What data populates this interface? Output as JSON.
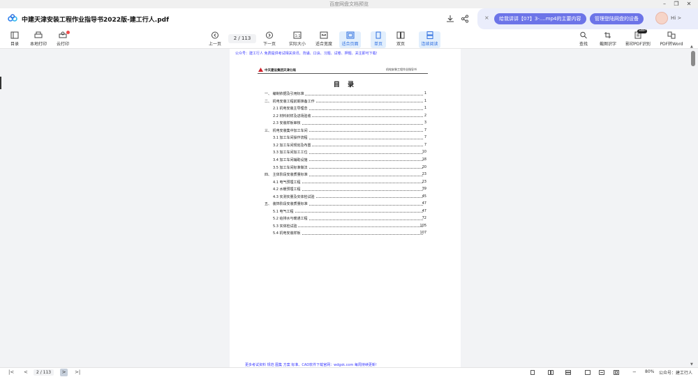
{
  "window": {
    "title": "百度网盘文档预览"
  },
  "header": {
    "filename": "中建天津安装工程作业指导书2022版-建工行人.pdf",
    "pill1": "给我讲讲【07】3-....mp4的主要内容",
    "pill2": "管理登陆网盘的设备",
    "hi": "Hi >",
    "close": "×"
  },
  "toolbar": {
    "toc": "目录",
    "local_print": "本地打印",
    "cloud_print": "云打印",
    "prev": "上一页",
    "page_indicator": "2 / 113",
    "next": "下一页",
    "actual_size": "实际大小",
    "fit_width": "适合宽度",
    "fit_page": "适合页面",
    "single": "单页",
    "double": "双页",
    "continuous": "连续阅读",
    "find": "查找",
    "screenshot_ocr": "截图识字",
    "image_pdf_ocr": "影印PDF识别",
    "pdf_to_word": "PDF转Word",
    "new_tag": "SWP"
  },
  "document": {
    "promo_top": "公众号：建工行人 免费提供考试相关资讯、背诵、口诀、习题、试卷、押题、关注即可下载!",
    "company": "中天建设集团天津分局",
    "header_right": "机电安装工程作业指导书",
    "toc_title": "目 录",
    "toc": [
      {
        "label": "一、 编制依据及引用标准",
        "page": "1",
        "indent": 0
      },
      {
        "label": "二、 机电安装工程前期准备工作",
        "page": "1",
        "indent": 0
      },
      {
        "label": "2.1 机电安装主导理念",
        "page": "1",
        "indent": 1
      },
      {
        "label": "2.2 材料封样及进场验收",
        "page": "2",
        "indent": 1
      },
      {
        "label": "2.3 安装样板审核",
        "page": "3",
        "indent": 1
      },
      {
        "label": "三、 机电安装集中加工车间",
        "page": "7",
        "indent": 0
      },
      {
        "label": "3.1 加工车间操作流程",
        "page": "7",
        "indent": 1
      },
      {
        "label": "3.2 加工车间规划及布置",
        "page": "7",
        "indent": 1
      },
      {
        "label": "3.3 加工车间加工工位",
        "page": "10",
        "indent": 1
      },
      {
        "label": "3.4 加工车间辅助设施",
        "page": "18",
        "indent": 1
      },
      {
        "label": "3.5 加工车间标准做法",
        "page": "20",
        "indent": 1
      },
      {
        "label": "四、 主体阶段安装质量标准",
        "page": "23",
        "indent": 0
      },
      {
        "label": "4.1 电气预埋工程",
        "page": "23",
        "indent": 1
      },
      {
        "label": "4.2 水暖预埋工程",
        "page": "39",
        "indent": 1
      },
      {
        "label": "4.3 实测实量及实体检试验",
        "page": "45",
        "indent": 1
      },
      {
        "label": "五、 装饰阶段安装质量标准",
        "page": "47",
        "indent": 0
      },
      {
        "label": "5.1 电气工程",
        "page": "47",
        "indent": 1
      },
      {
        "label": "5.2 给排水与暖通工程",
        "page": "72",
        "indent": 1
      },
      {
        "label": "5.3 实体检试验",
        "page": "105",
        "indent": 1
      },
      {
        "label": "5.4 机电安装样板",
        "page": "107",
        "indent": 1
      }
    ],
    "promo_bottom": "更多考试资料 规范 图集 方案 标准、CAD软件下载官网：wdgsk.com 每周持续更新!"
  },
  "bottombar": {
    "page_indicator": "2 / 113",
    "zoom": "80%",
    "gzh": "公众号：建工行人"
  },
  "colors": {
    "accent": "#2f6fe0",
    "pill": "#6c74e8",
    "promo": "#3a3aff"
  }
}
